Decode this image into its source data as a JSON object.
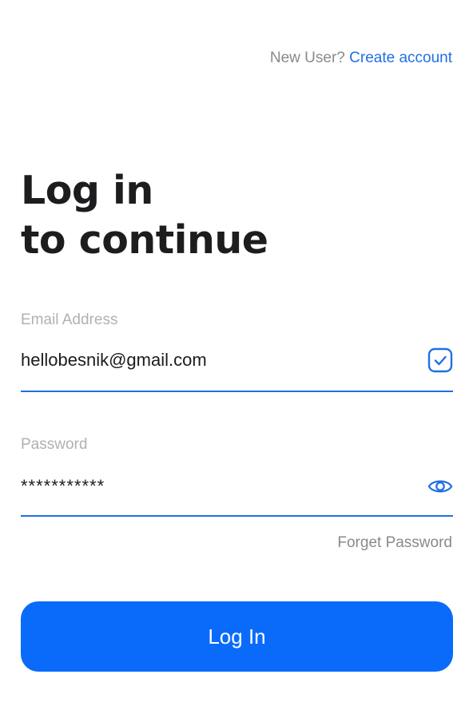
{
  "header": {
    "new_user_text": "New User?",
    "create_account_label": "Create account"
  },
  "title": {
    "line1": "Log in",
    "line2": "to continue"
  },
  "email": {
    "label": "Email Address",
    "value": "hellobesnik@gmail.com",
    "status_icon": "check-square-icon"
  },
  "password": {
    "label": "Password",
    "value": "***********",
    "toggle_icon": "eye-icon"
  },
  "forgot_password_label": "Forget Password",
  "login_button_label": "Log In",
  "colors": {
    "accent": "#1f6fe5",
    "button": "#0a6bfb",
    "muted_text": "#8a8a8e",
    "label_text": "#b1b1b5",
    "title_text": "#1d1d1f"
  }
}
